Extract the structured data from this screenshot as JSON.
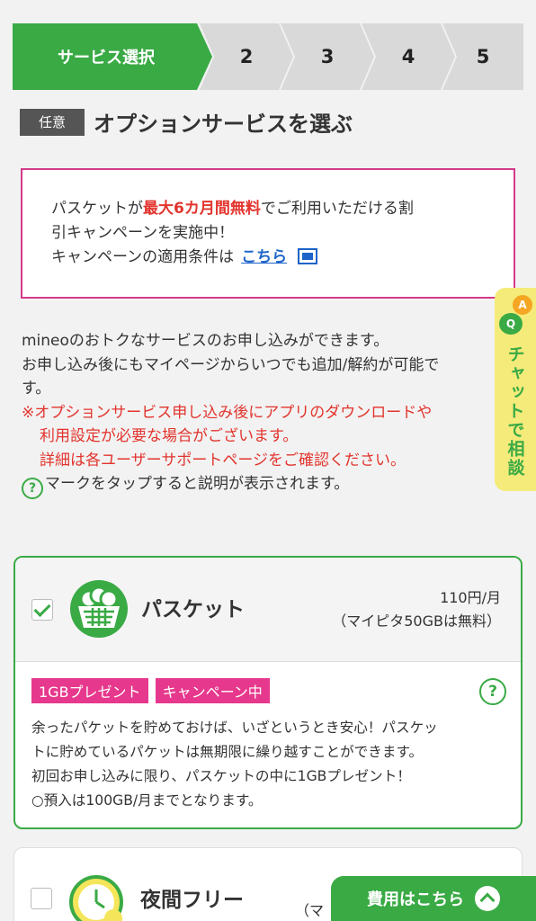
{
  "steps": [
    {
      "label": "サービス選択",
      "active": true
    },
    {
      "label": "2"
    },
    {
      "label": "3"
    },
    {
      "label": "4"
    },
    {
      "label": "5"
    }
  ],
  "heading": {
    "tag": "任意",
    "title": "オプションサービスを選ぶ"
  },
  "campaign": {
    "line1_pre": "パスケットが",
    "line1_hl": "最大6カ月間無料",
    "line1_post": "でご利用いただける割",
    "line2": "引キャンペーンを実施中！",
    "line3": "キャンペーンの適用条件は",
    "link": "こちら"
  },
  "description": {
    "line1": "mineoのおトクなサービスのお申し込みができます。",
    "line2": "お申し込み後にもマイページからいつでも追加/解約が可能で",
    "line3": "す。",
    "warn1": "※オプションサービス申し込み後にアプリのダウンロードや",
    "warn2": "利用設定が必要な場合がございます。",
    "warn3": "詳細は各ユーザーサポートページをご確認ください。",
    "help_icon": "?",
    "help_note": "マークをタップすると説明が表示されます。"
  },
  "chat": {
    "badge_a": "A",
    "badge_q": "Q",
    "label": "チャットで相談"
  },
  "options": [
    {
      "name": "パスケット",
      "checked": true,
      "price": "110円/月",
      "price_note": "（マイピタ50GBは無料）",
      "badges": [
        "1GBプレゼント",
        "キャンペーン中"
      ],
      "help_icon": "?",
      "body": [
        "余ったパケットを貯めておけば、いざというとき安心！パスケッ",
        "トに貯めているパケットは無期限に繰り越すことができます。",
        "初回お申し込みに限り、パスケットの中に1GBプレゼント！",
        "○預入は100GB/月までとなります。"
      ]
    },
    {
      "name": "夜間フリー",
      "checked": false,
      "price_partial": "（マ"
    }
  ],
  "costbar": {
    "label": "費用はこちら"
  },
  "colors": {
    "brand_green": "#3aaa45",
    "accent_pink": "#e6388c",
    "alert_red": "#e2342d",
    "link_blue": "#1d63c8",
    "chat_yellow": "#f5eb7a"
  }
}
